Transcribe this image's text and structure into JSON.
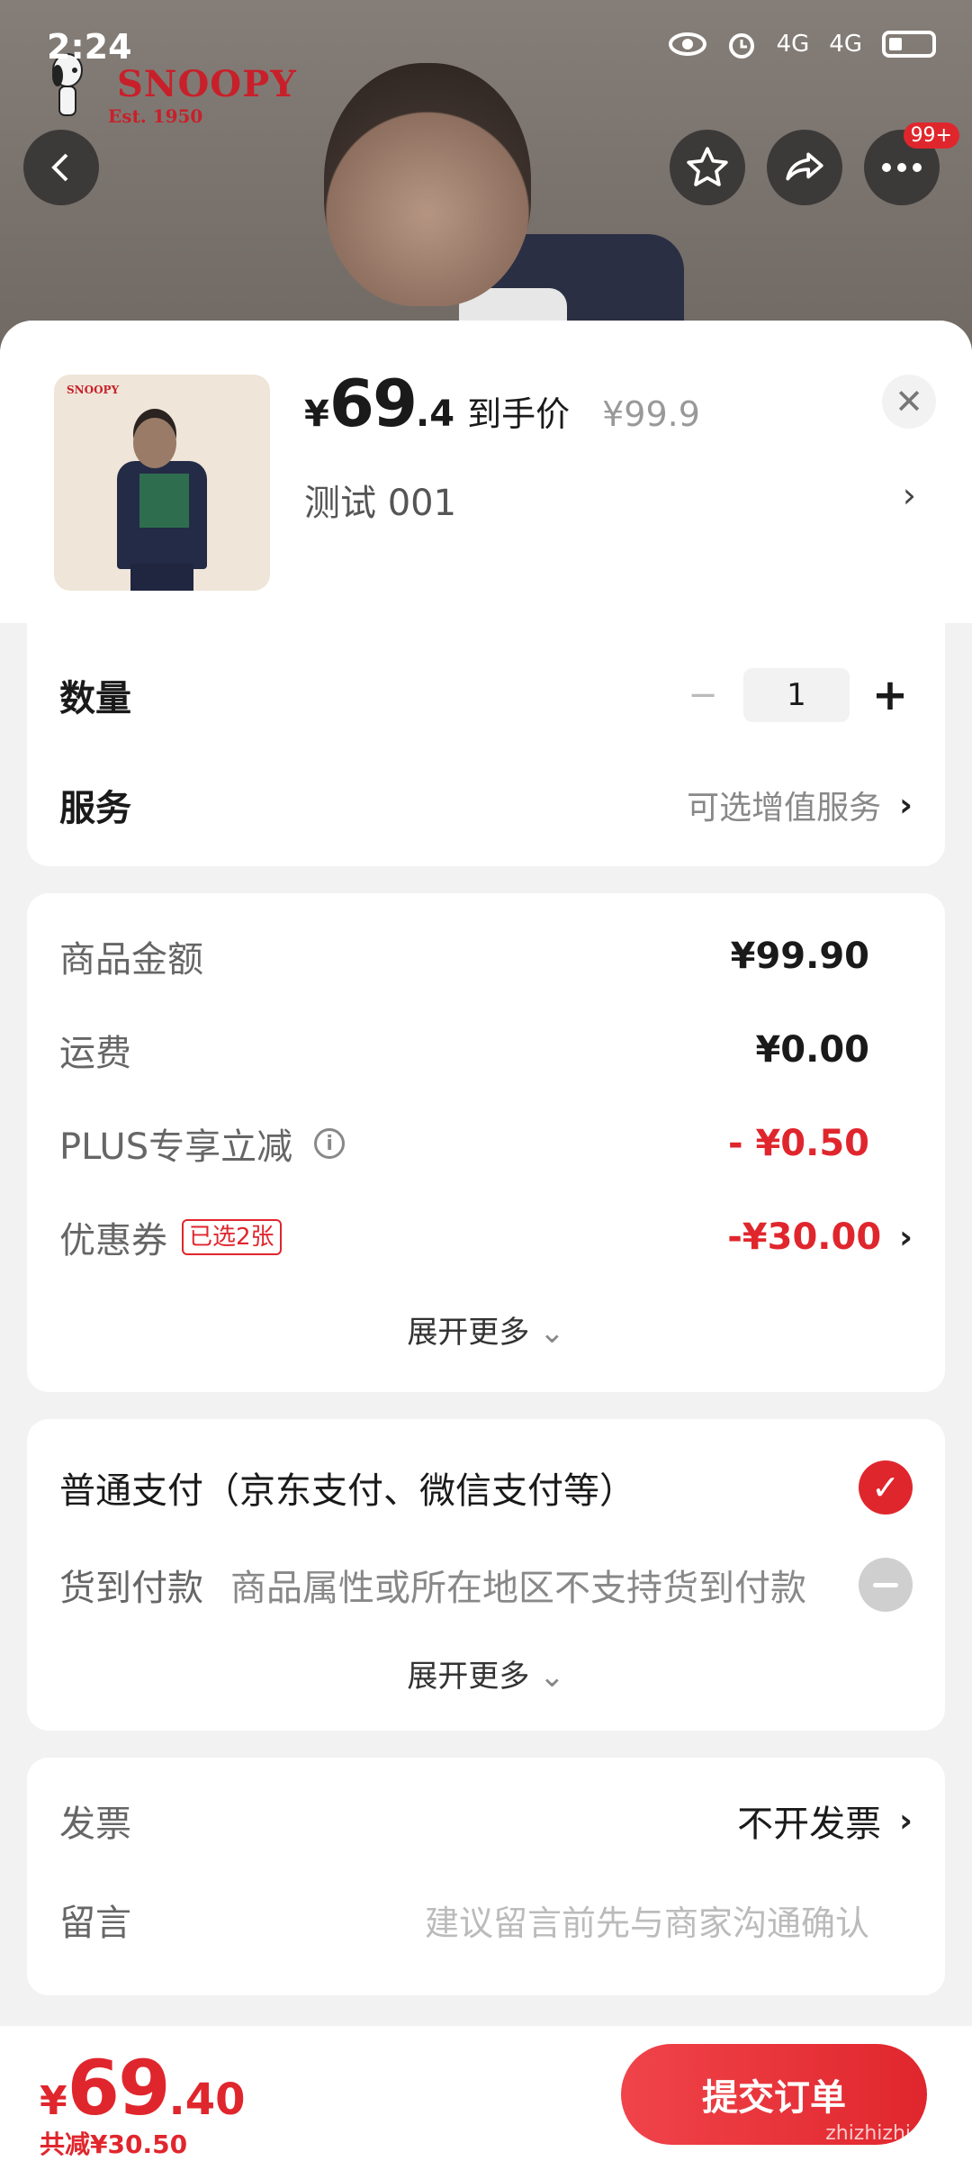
{
  "status_bar": {
    "time": "2:24",
    "network": "4G"
  },
  "brand": {
    "name": "SNOOPY",
    "sub": "Est. 1950"
  },
  "top_actions": {
    "more_badge": "99+"
  },
  "product": {
    "currency": "¥",
    "price_int": "69",
    "price_dec": ".4",
    "price_label": "到手价",
    "original_price": "¥99.9",
    "spec": "测试  001"
  },
  "quantity": {
    "label": "数量",
    "value": "1"
  },
  "service": {
    "label": "服务",
    "value": "可选增值服务"
  },
  "amounts": {
    "goods_label": "商品金额",
    "goods_value": "¥99.90",
    "shipping_label": "运费",
    "shipping_value": "¥0.00",
    "plus_label": "PLUS专享立减",
    "plus_value": "- ¥0.50",
    "coupon_label": "优惠券",
    "coupon_tag": "已选2张",
    "coupon_value": "-¥30.00",
    "expand": "展开更多"
  },
  "payment": {
    "normal_label": "普通支付（京东支付、微信支付等）",
    "cod_label": "货到付款",
    "cod_note": "商品属性或所在地区不支持货到付款",
    "expand": "展开更多"
  },
  "extra": {
    "invoice_label": "发票",
    "invoice_value": "不开发票",
    "note_label": "留言",
    "note_placeholder": "建议留言前先与商家沟通确认"
  },
  "footer": {
    "currency": "¥",
    "total_int": "69",
    "total_dec": ".40",
    "saved": "共减¥30.50",
    "submit": "提交订单",
    "watermark": "zhizhizhi.com"
  },
  "colors": {
    "accent": "#e0262d"
  }
}
